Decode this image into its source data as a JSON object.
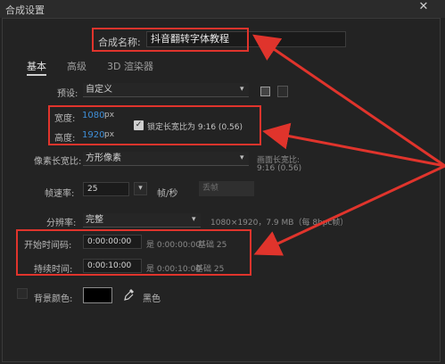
{
  "window": {
    "title": "合成设置",
    "close_icon": "close-icon"
  },
  "comp_name": {
    "label": "合成名称:",
    "value": "抖音翻转字体教程"
  },
  "tabs": [
    {
      "label": "基本",
      "active": true
    },
    {
      "label": "高级",
      "active": false
    },
    {
      "label": "3D 渲染器",
      "active": false
    }
  ],
  "preset": {
    "label": "预设:",
    "value": "自定义"
  },
  "size": {
    "width_label": "宽度:",
    "width_value": "1080",
    "width_unit": "px",
    "height_label": "高度:",
    "height_value": "1920",
    "height_unit": "px",
    "lock_label": "锁定长宽比为 9:16 (0.56)",
    "lock_checked": true
  },
  "pixel_aspect": {
    "label": "像素长宽比:",
    "value": "方形像素",
    "frame_aspect_label": "画面长宽比:",
    "frame_aspect_value": "9:16 (0.56)"
  },
  "frame_rate": {
    "label": "帧速率:",
    "value": "25",
    "unit": "帧/秒",
    "drop_value": "丢帧"
  },
  "resolution": {
    "label": "分辨率:",
    "value": "完整",
    "info": "1080×1920，7.9 MB（每 8bpc帧）"
  },
  "start_timecode": {
    "label": "开始时间码:",
    "value": "0:00:00:00",
    "equals": "是 0:00:00:00",
    "base": "基础 25"
  },
  "duration": {
    "label": "持续时间:",
    "value": "0:00:10:00",
    "equals": "是 0:00:10:00",
    "base": "基础 25"
  },
  "background": {
    "label": "背景颜色:",
    "color": "#000000",
    "color_name": "黑色"
  },
  "colors": {
    "accent_red": "#e0342c",
    "link_blue": "#3f8fd8",
    "dialog_bg": "#232323"
  }
}
